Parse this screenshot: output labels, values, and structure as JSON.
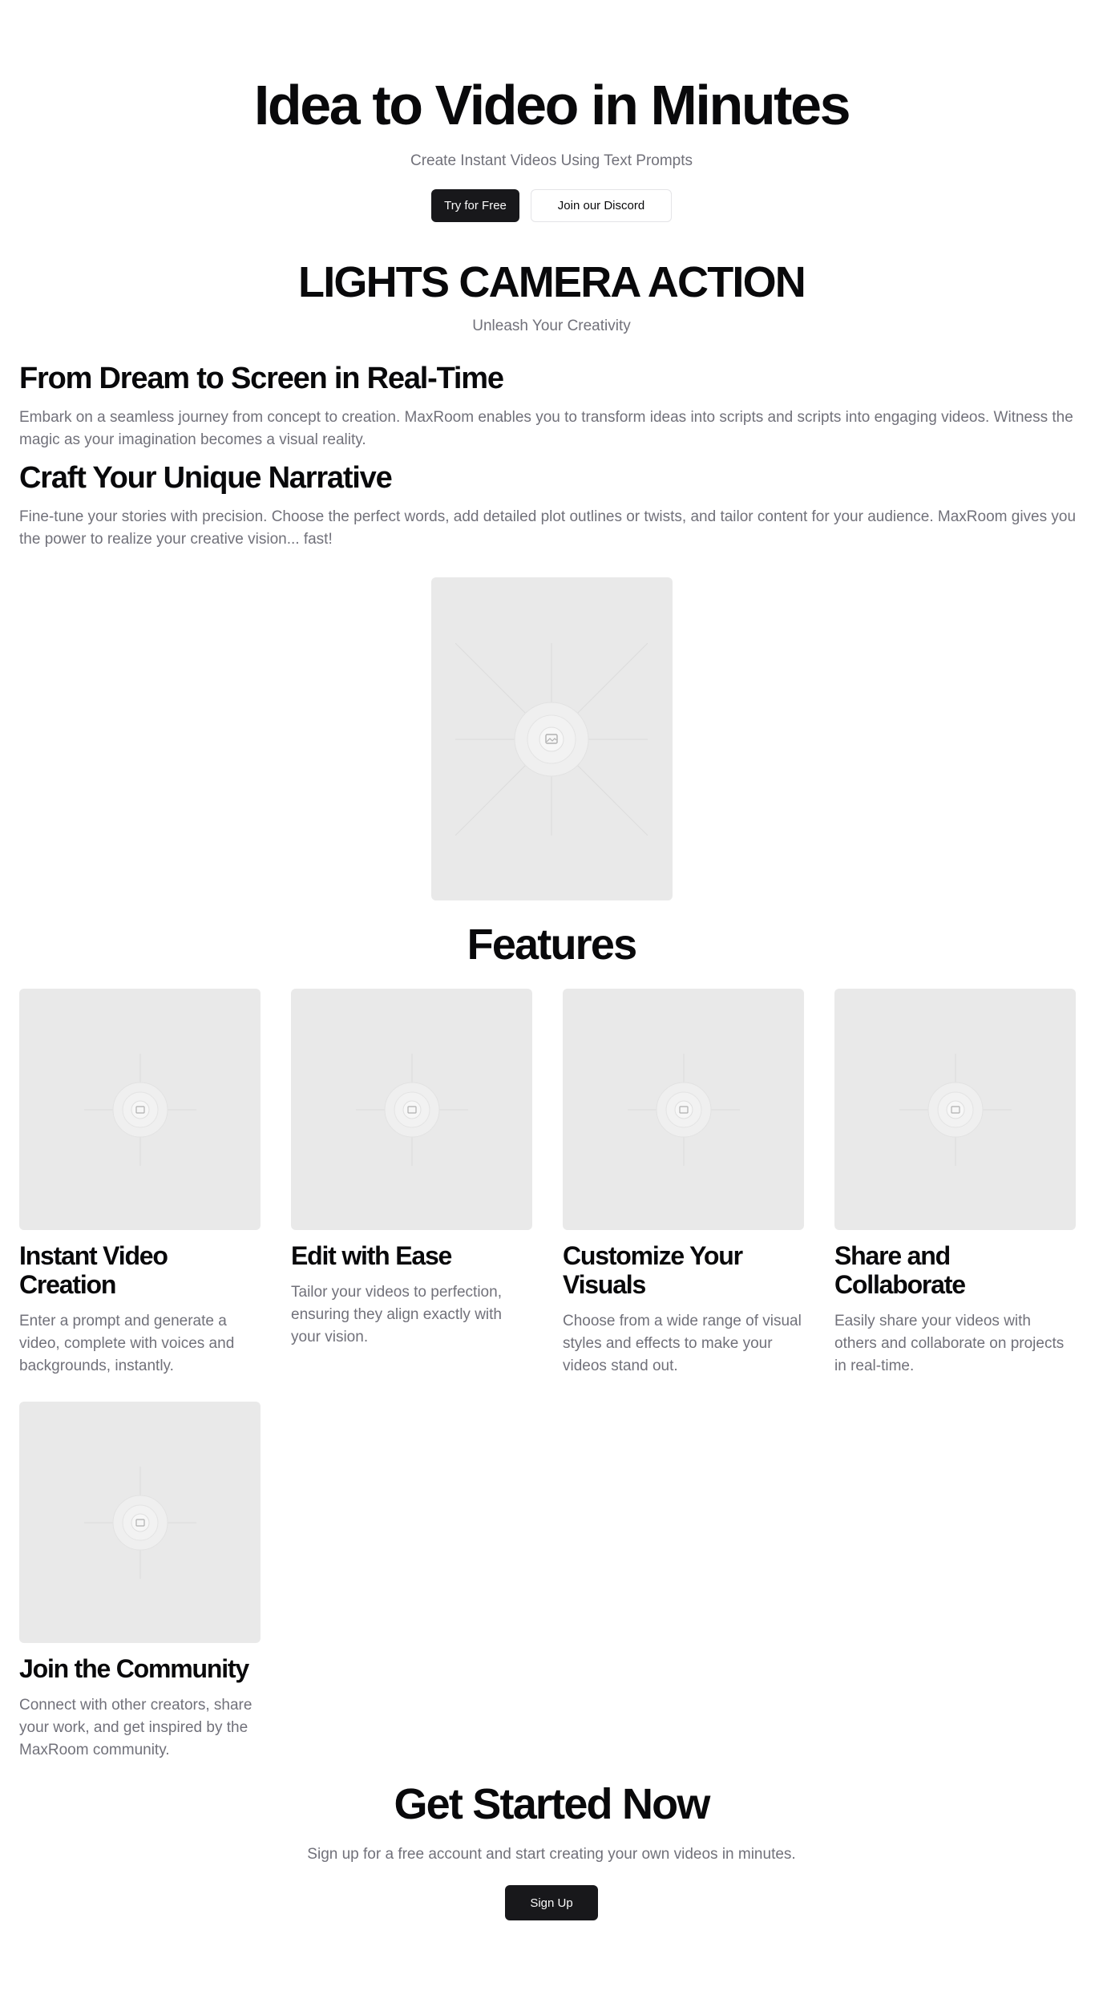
{
  "hero": {
    "title": "Idea to Video in Minutes",
    "subtitle": "Create Instant Videos Using Text Prompts",
    "primary_button": "Try for Free",
    "secondary_button": "Join our Discord"
  },
  "lights": {
    "title": "LIGHTS CAMERA ACTION",
    "subtitle": "Unleash Your Creativity"
  },
  "story": [
    {
      "heading": "From Dream to Screen in Real-Time",
      "body": "Embark on a seamless journey from concept to creation. MaxRoom enables you to transform ideas into scripts and scripts into engaging videos. Witness the magic as your imagination becomes a visual reality."
    },
    {
      "heading": "Craft Your Unique Narrative",
      "body": "Fine-tune your stories with precision. Choose the perfect words, add detailed plot outlines or twists, and tailor content for your audience. MaxRoom gives you the power to realize your creative vision... fast!"
    }
  ],
  "media_icon": "image-placeholder-icon",
  "features": {
    "title": "Features",
    "items": [
      {
        "title": "Instant Video Creation",
        "body": "Enter a prompt and generate a video, complete with voices and backgrounds, instantly."
      },
      {
        "title": "Edit with Ease",
        "body": "Tailor your videos to perfection, ensuring they align exactly with your vision."
      },
      {
        "title": "Customize Your Visuals",
        "body": "Choose from a wide range of visual styles and effects to make your videos stand out."
      },
      {
        "title": "Share and Collaborate",
        "body": "Easily share your videos with others and collaborate on projects in real-time."
      },
      {
        "title": "Join the Community",
        "body": "Connect with other creators, share your work, and get inspired by the MaxRoom community."
      }
    ]
  },
  "cta": {
    "title": "Get Started Now",
    "subtitle": "Sign up for a free account and start creating your own videos in minutes.",
    "button": "Sign Up"
  },
  "colors": {
    "primary": "#18181b",
    "muted_text": "#71717a",
    "placeholder_bg": "#e9e9e9"
  }
}
